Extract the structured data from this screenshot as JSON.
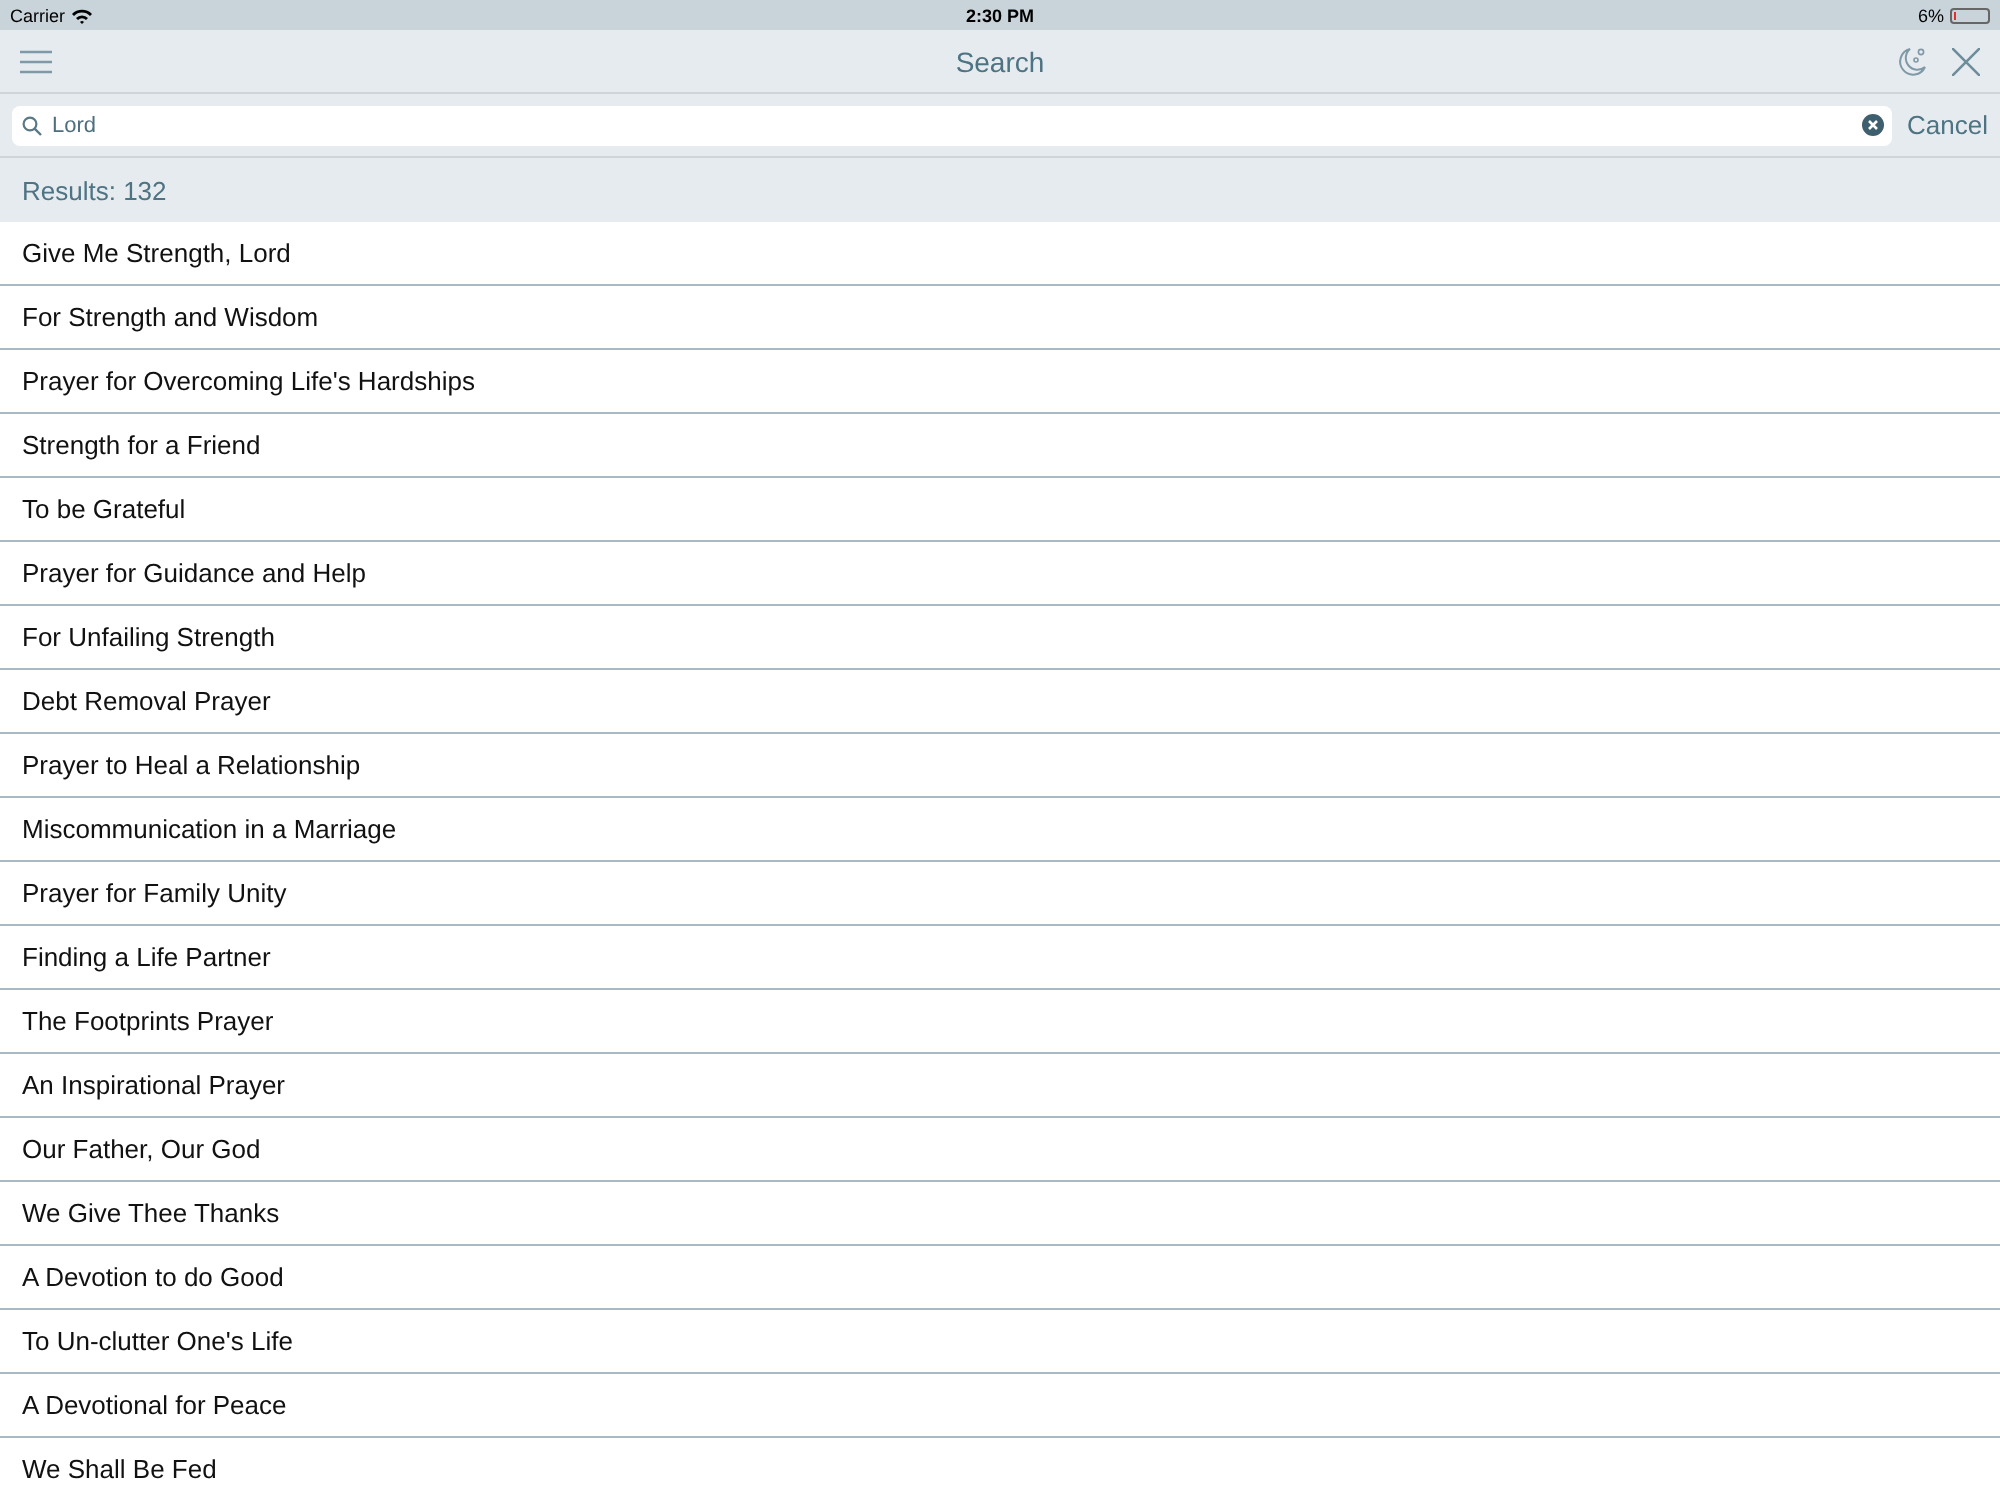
{
  "status_bar": {
    "carrier": "Carrier",
    "time": "2:30 PM",
    "battery_percent": "6%",
    "battery": {
      "level": 0.06
    }
  },
  "nav": {
    "title": "Search"
  },
  "search": {
    "value": "Lord",
    "cancel": "Cancel"
  },
  "results_header": "Results: 132",
  "results": [
    {
      "title": "Give Me Strength, Lord"
    },
    {
      "title": "For Strength and Wisdom"
    },
    {
      "title": "Prayer for Overcoming Life's Hardships"
    },
    {
      "title": "Strength for a Friend"
    },
    {
      "title": "To be Grateful"
    },
    {
      "title": "Prayer for Guidance and Help"
    },
    {
      "title": "For Unfailing Strength"
    },
    {
      "title": "Debt Removal Prayer"
    },
    {
      "title": "Prayer to Heal a Relationship"
    },
    {
      "title": "Miscommunication in a Marriage"
    },
    {
      "title": "Prayer for Family Unity"
    },
    {
      "title": "Finding a Life Partner"
    },
    {
      "title": "The Footprints Prayer"
    },
    {
      "title": "An Inspirational Prayer"
    },
    {
      "title": "Our Father, Our God"
    },
    {
      "title": "We Give Thee Thanks"
    },
    {
      "title": "A Devotion to do Good"
    },
    {
      "title": "To Un-clutter One's Life"
    },
    {
      "title": "A Devotional for Peace"
    },
    {
      "title": "We Shall Be Fed"
    }
  ]
}
